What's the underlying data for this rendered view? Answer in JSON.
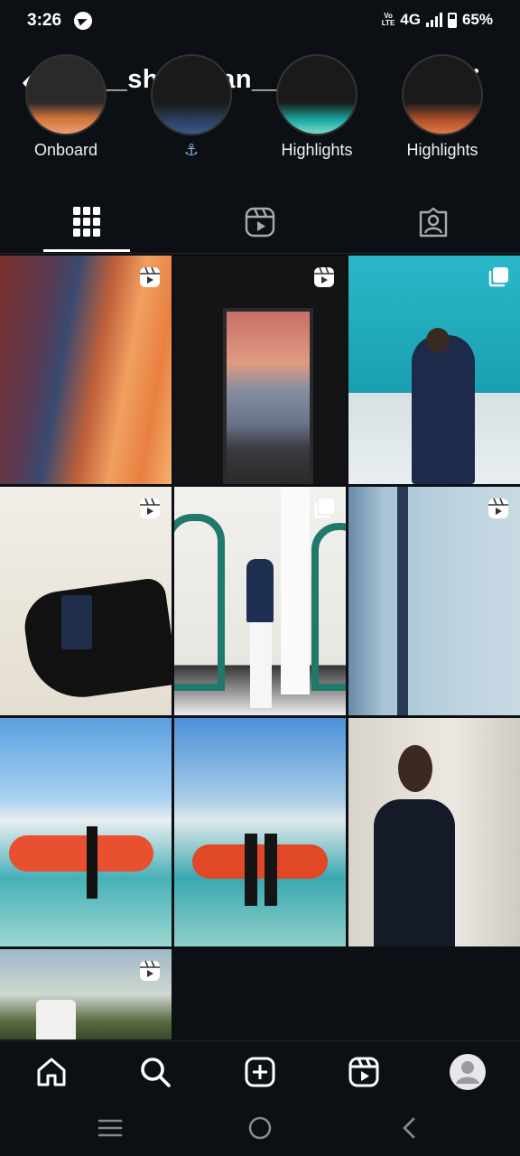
{
  "status_bar": {
    "time": "3:26",
    "network": "4G",
    "volte_line1": "Vo",
    "volte_line2": "LTE",
    "battery": "65%"
  },
  "header": {
    "username": "__sha__ban__"
  },
  "highlights": [
    {
      "label": "Onboard"
    },
    {
      "label": "⚓"
    },
    {
      "label": "Highlights"
    },
    {
      "label": "Highlights"
    }
  ],
  "tabs": [
    {
      "name": "posts-grid",
      "icon": "grid-icon",
      "active": true
    },
    {
      "name": "reels",
      "icon": "reels-icon",
      "active": false
    },
    {
      "name": "tagged",
      "icon": "tagged-person-icon",
      "active": false
    }
  ],
  "posts": [
    {
      "type": "reel",
      "scene": "sunset-over-containers"
    },
    {
      "type": "reel",
      "scene": "cabin-door-sunset"
    },
    {
      "type": "carousel",
      "scene": "man-on-ship-deck"
    },
    {
      "type": "reel",
      "scene": "passport-in-hand"
    },
    {
      "type": "carousel",
      "scene": "man-in-white-archway"
    },
    {
      "type": "reel",
      "scene": "aerial-sea-view"
    },
    {
      "type": "none",
      "scene": "lifeboat-on-deck"
    },
    {
      "type": "none",
      "scene": "two-men-by-lifeboat"
    },
    {
      "type": "none",
      "scene": "man-in-black-shirt"
    },
    {
      "type": "reel",
      "scene": "road-with-bus"
    }
  ],
  "bottom_nav": [
    {
      "name": "home",
      "icon": "home-icon"
    },
    {
      "name": "search",
      "icon": "search-icon"
    },
    {
      "name": "create",
      "icon": "plus-square-icon"
    },
    {
      "name": "reels",
      "icon": "reels-icon"
    },
    {
      "name": "profile",
      "icon": "avatar-icon"
    }
  ],
  "colors": {
    "background": "#0c1014",
    "text": "#ffffff",
    "divider": "#262626"
  }
}
